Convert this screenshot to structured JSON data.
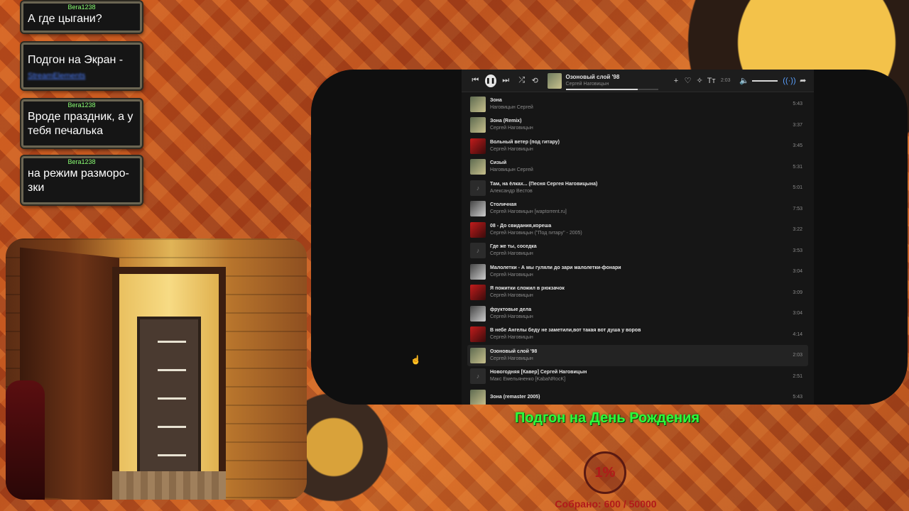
{
  "chat": {
    "messages": [
      {
        "user": "Вега1238",
        "text": "А где цыгани?"
      },
      {
        "user": "",
        "text": "Подгон на Экран -",
        "link": "StreamElements"
      },
      {
        "user": "Вега1238",
        "text": "Вроде праздник, а у тебя печалька"
      },
      {
        "user": "Вега1238",
        "text": "на режим разморо-зки"
      }
    ]
  },
  "player": {
    "now_playing": {
      "title": "Озоновый слой '98",
      "artist": "Сергей Наговицын",
      "time": "2:03",
      "progress": 0.78
    },
    "volume": 0.9,
    "tracks": [
      {
        "title": "Зона",
        "artist": "Наговицын Сергей",
        "duration": "5:43",
        "cover": "a"
      },
      {
        "title": "Зона (Remix)",
        "artist": "Сергей Наговицын",
        "duration": "3:37",
        "cover": "a"
      },
      {
        "title": "Вольный ветер (под гитару)",
        "artist": "Сергей Наговицын",
        "duration": "3:45",
        "cover": "b"
      },
      {
        "title": "Сизый",
        "artist": "Наговицын Сергей",
        "duration": "5:31",
        "cover": "a"
      },
      {
        "title": "Там, на ёлках... (Песня Сергея Наговицына)",
        "artist": "Александр Вестов",
        "duration": "5:01",
        "cover": "c"
      },
      {
        "title": "Столичная",
        "artist": "Сергей Наговицын [waptorrent.ru]",
        "duration": "7:53",
        "cover": "d"
      },
      {
        "title": "08 - До свидания,кореша",
        "artist": "Сергей Наговицын (\"Под гитару\" - 2005)",
        "duration": "3:22",
        "cover": "b"
      },
      {
        "title": "Где же ты, соседка",
        "artist": "Сергей Наговицын",
        "duration": "3:53",
        "cover": "c"
      },
      {
        "title": "Малолетки - А мы гуляли до зари малолетки-фонари",
        "artist": "Сергей Наговицын",
        "duration": "3:04",
        "cover": "d"
      },
      {
        "title": "Я пожитки сложил в рюкзачок",
        "artist": "Сергей Наговицын",
        "duration": "3:09",
        "cover": "b"
      },
      {
        "title": "фруктовые дела",
        "artist": "Сергей Наговицын",
        "duration": "3:04",
        "cover": "d"
      },
      {
        "title": "В небе Ангелы беду не заметили,вот такая вот душа у воров",
        "artist": "Сергей Наговицын",
        "duration": "4:14",
        "cover": "b"
      },
      {
        "title": "Озоновый слой '98",
        "artist": "Сергей Наговицын",
        "duration": "2:03",
        "cover": "a",
        "active": true
      },
      {
        "title": "Новогодняя [Кавер] Сергей Наговицын",
        "artist": "Макс Емельяненко [KabaNRocK]",
        "duration": "2:51",
        "cover": "c"
      },
      {
        "title": "Зона (remaster 2005)",
        "artist": "",
        "duration": "5:43",
        "cover": "a"
      }
    ]
  },
  "goal": {
    "title": "Подгон на День Рождения",
    "percent": "1%",
    "collected": "Собрано: 600 / 50000"
  },
  "colors": {
    "goal_green": "#2cff3c",
    "goal_red": "#b11a1a",
    "chat_user": "#8bff74"
  }
}
